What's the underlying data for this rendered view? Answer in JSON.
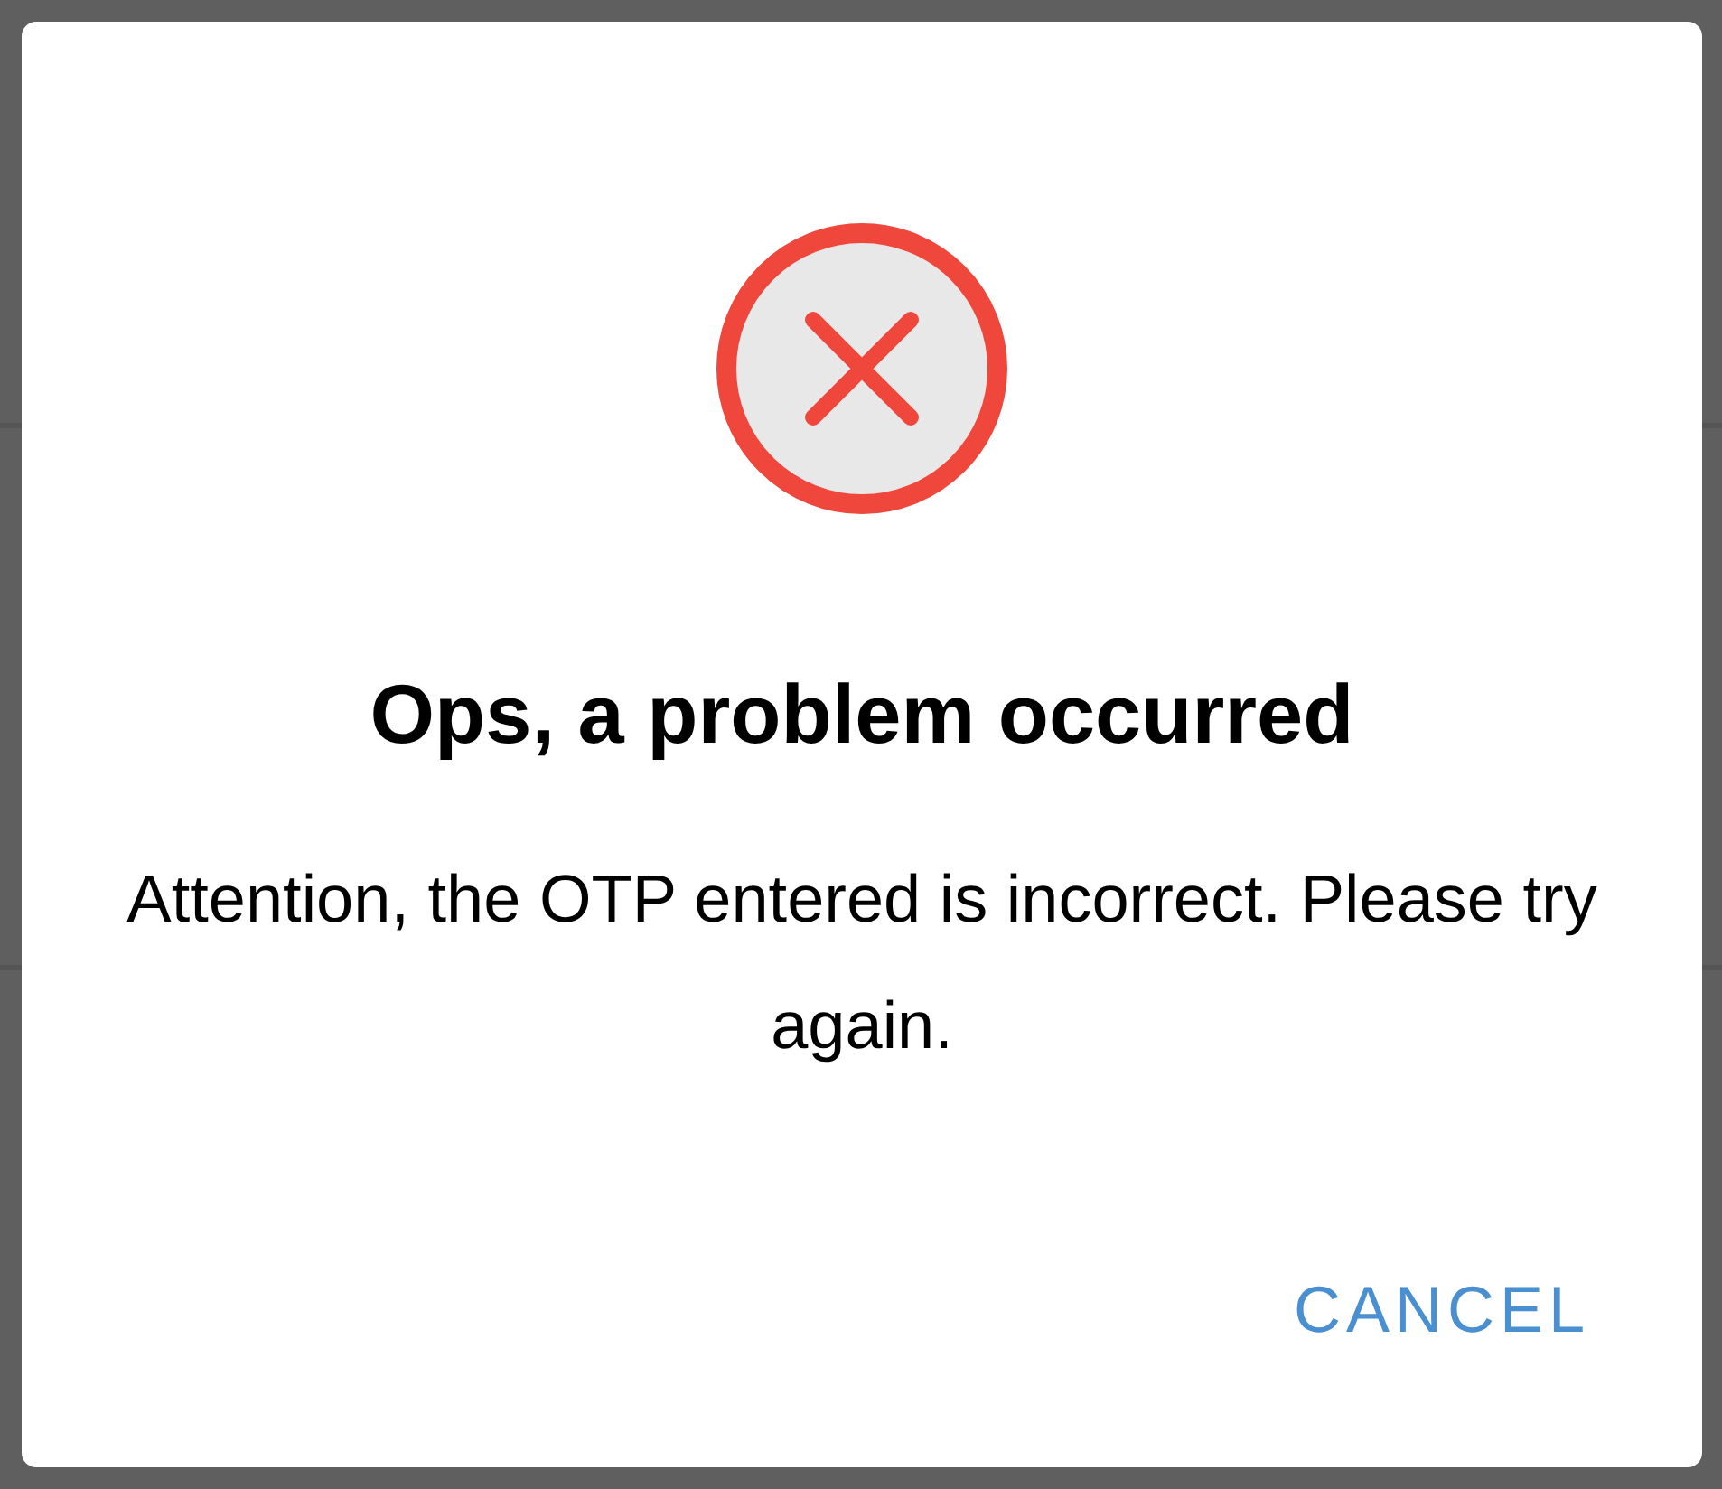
{
  "dialog": {
    "title": "Ops, a problem occurred",
    "message": "Attention, the OTP entered is incorrect. Please try again.",
    "buttons": [
      {
        "label": "CANCEL"
      }
    ]
  }
}
